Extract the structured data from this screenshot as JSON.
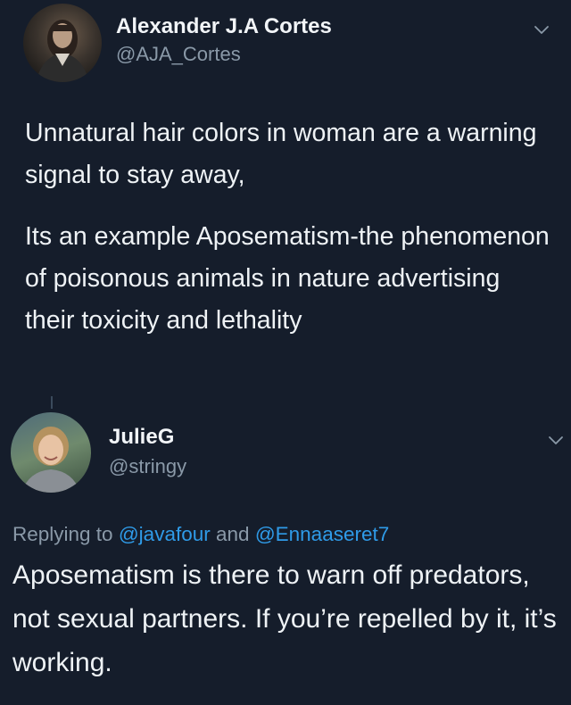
{
  "tweets": [
    {
      "author_name": "Alexander J.A Cortes",
      "author_handle": "@AJA_Cortes",
      "paragraphs": [
        "Unnatural hair colors in woman are a warning signal to stay away,",
        "Its an example Aposematism-the phenomenon of poisonous animals in nature advertising their toxicity and lethality"
      ],
      "avatar_icon": "man-long-hair-avatar",
      "menu_icon": "chevron-down-icon"
    },
    {
      "author_name": "JulieG",
      "author_handle": "@stringy",
      "replying_prefix": "Replying to",
      "replying_mention_1": "@javafour",
      "replying_joiner": "and",
      "replying_mention_2": "@Ennaaseret7",
      "text": "Aposematism is there to warn off predators, not sexual partners. If you’re repelled by it, it’s working.",
      "avatar_icon": "woman-smiling-avatar",
      "menu_icon": "chevron-down-icon"
    }
  ],
  "colors": {
    "background": "#151d2b",
    "text": "#e9eef3",
    "secondary_text": "#8a99a8",
    "link": "#2f9be8"
  }
}
